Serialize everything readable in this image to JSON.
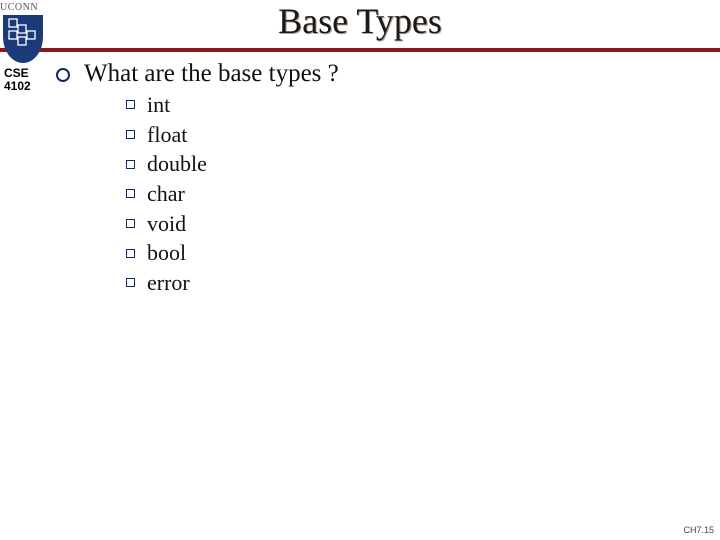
{
  "org_label": "UCONN",
  "title": "Base Types",
  "course": {
    "dept": "CSE",
    "number": "4102"
  },
  "question": "What are the base types ?",
  "items": [
    "int",
    "float",
    "double",
    "char",
    "void",
    "bool",
    "error"
  ],
  "footer": "CH7.15",
  "colors": {
    "accent": "#8a1a1a",
    "shield": "#1b3a7a",
    "bullet": "#0a2a6a"
  }
}
